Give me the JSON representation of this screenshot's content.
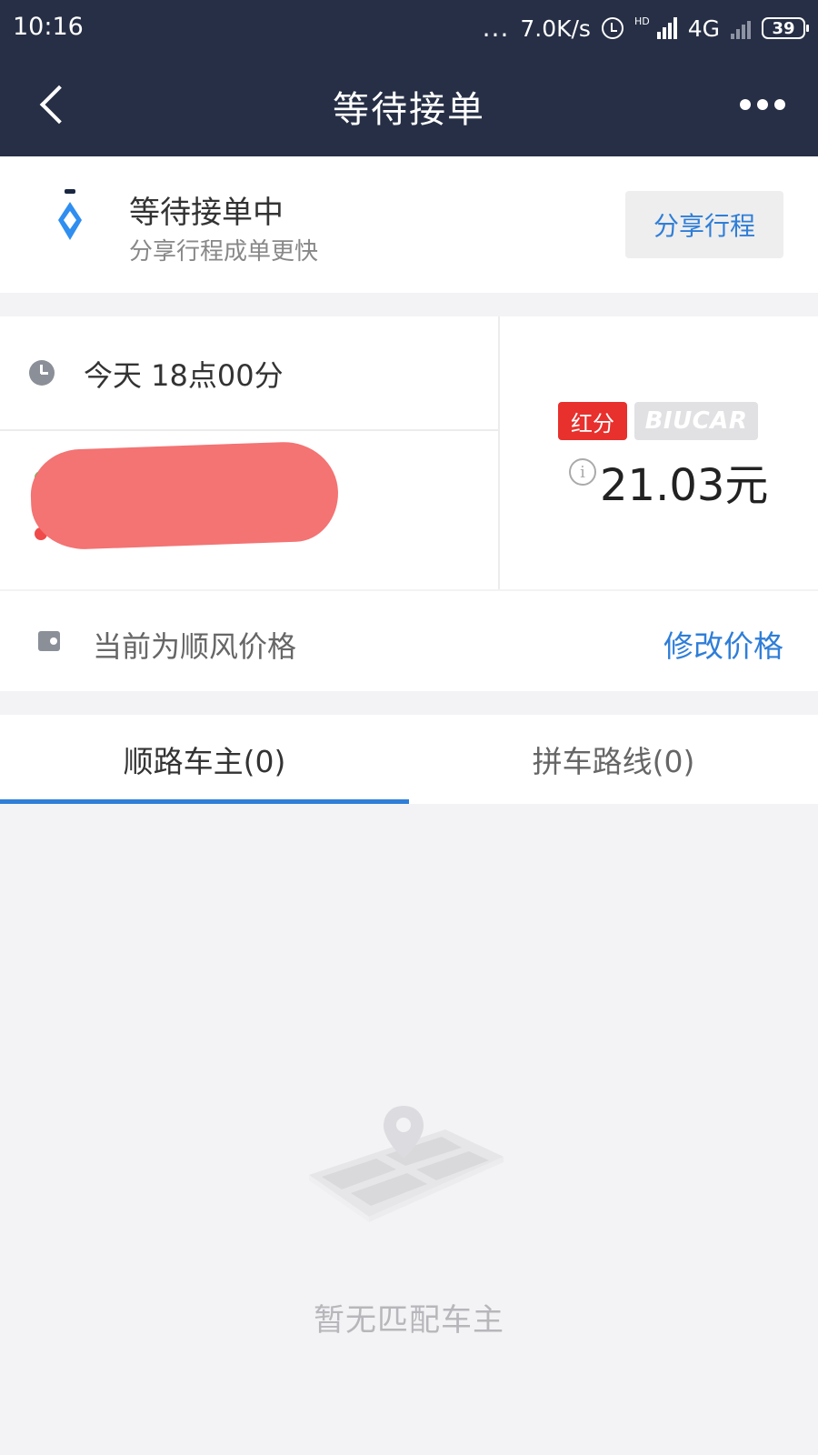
{
  "status_bar": {
    "time": "10:16",
    "dots": "...",
    "net_speed": "7.0K/s",
    "hd": "HD",
    "network": "4G",
    "battery": "39"
  },
  "nav": {
    "title": "等待接单"
  },
  "waiting": {
    "title": "等待接单中",
    "subtitle": "分享行程成单更快",
    "share_button": "分享行程"
  },
  "trip": {
    "time": "今天 18点00分",
    "badge_red": "红分",
    "badge_gray": "BIUCAR",
    "info_symbol": "i",
    "price": "21.03元"
  },
  "price_row": {
    "note": "当前为顺风价格",
    "edit_button": "修改价格"
  },
  "tabs": [
    {
      "label": "顺路车主(0)",
      "active": true
    },
    {
      "label": "拼车路线(0)",
      "active": false
    }
  ],
  "empty": {
    "text": "暂无匹配车主"
  },
  "colors": {
    "nav_bg": "#262f45",
    "accent_blue": "#2f7ed8",
    "badge_red": "#e8302d",
    "redaction": "#f47373"
  }
}
